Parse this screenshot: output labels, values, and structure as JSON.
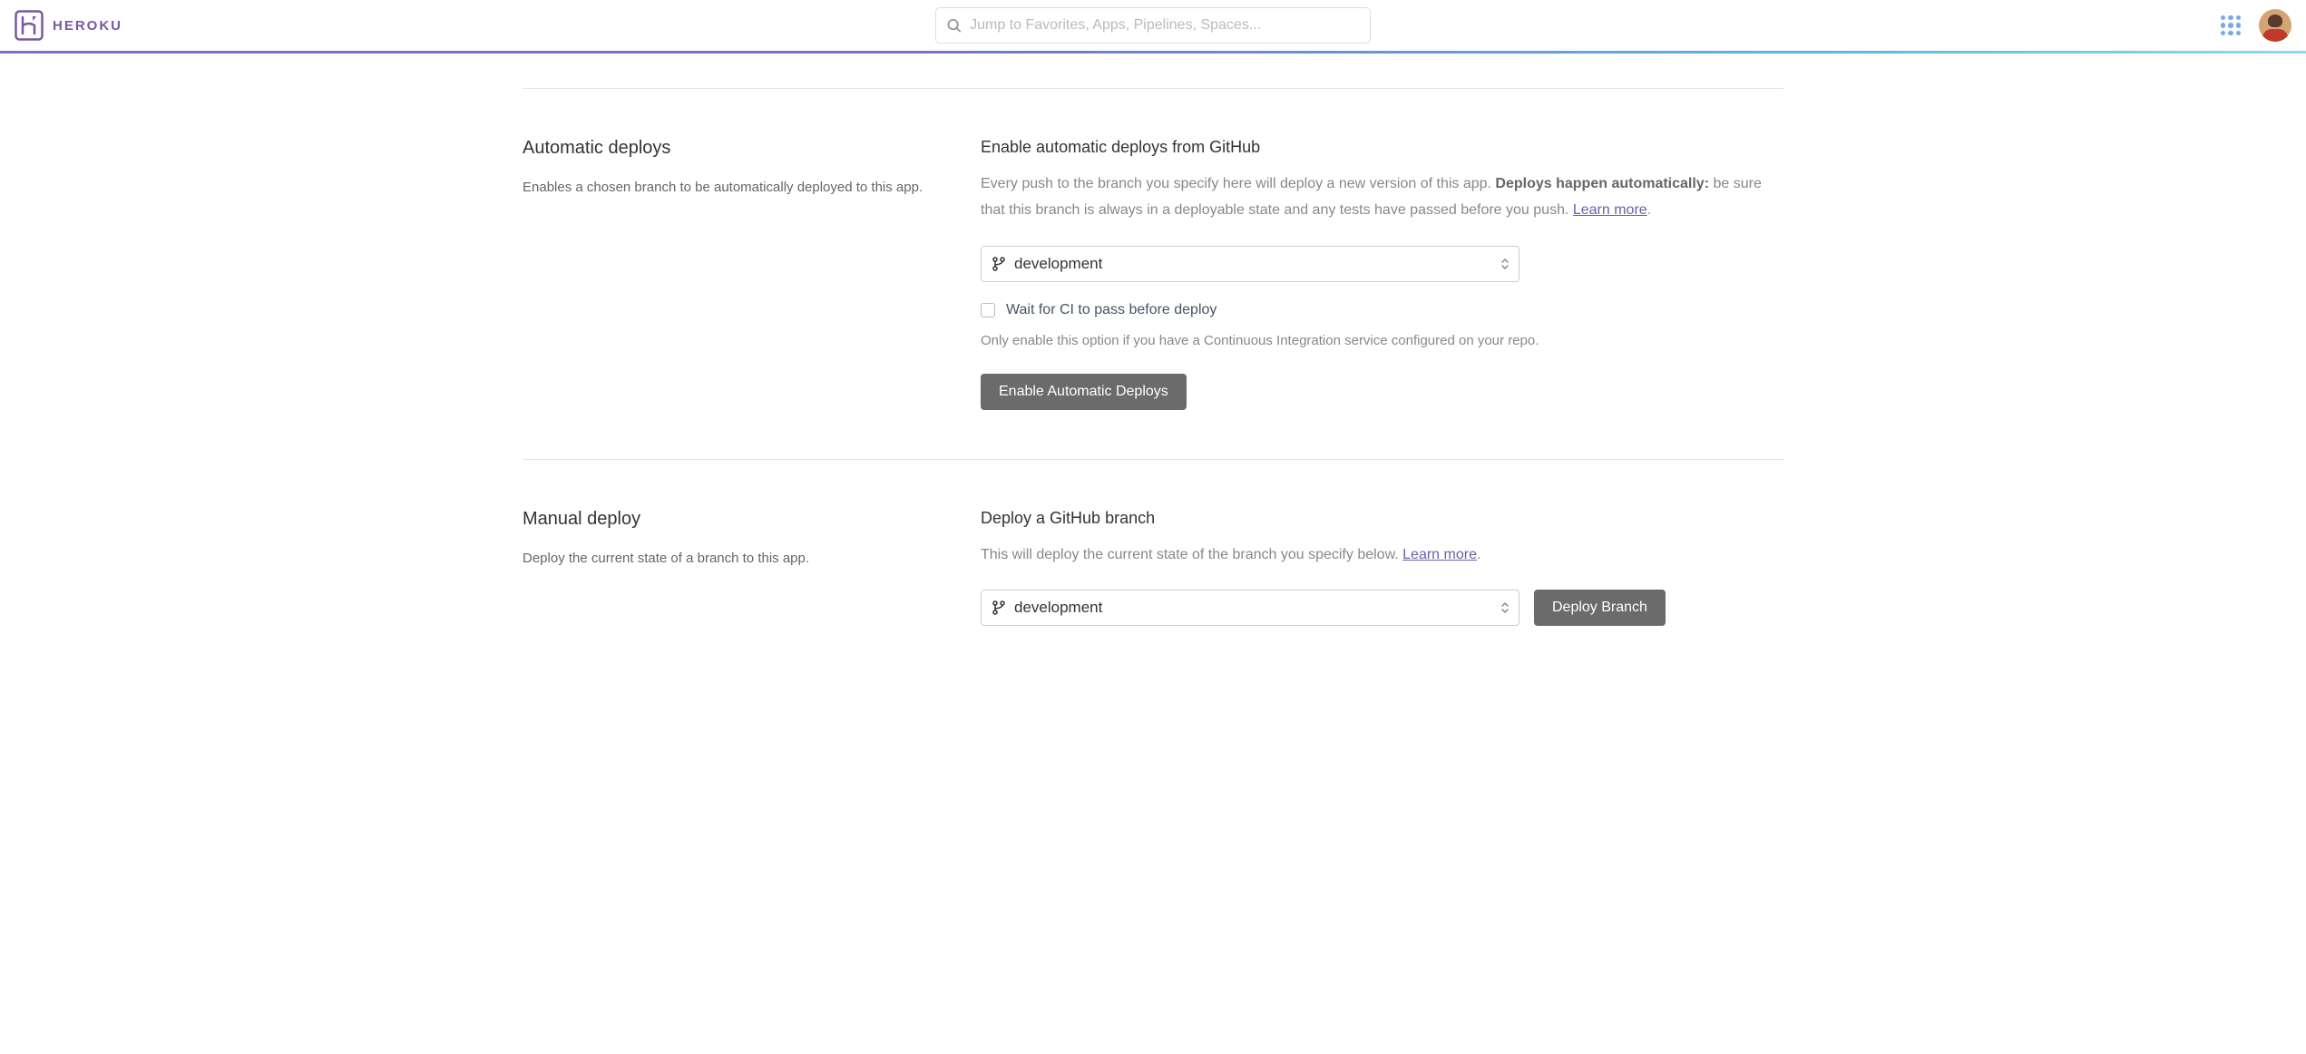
{
  "header": {
    "brand": "HEROKU",
    "search_placeholder": "Jump to Favorites, Apps, Pipelines, Spaces..."
  },
  "auto": {
    "title": "Automatic deploys",
    "subtitle": "Enables a chosen branch to be automatically deployed to this app.",
    "heading": "Enable automatic deploys from GitHub",
    "desc_part1": "Every push to the branch you specify here will deploy a new version of this app. ",
    "desc_bold": "Deploys happen automatically:",
    "desc_part2": " be sure that this branch is always in a deployable state and any tests have passed before you push. ",
    "learn_more": "Learn more",
    "period": ".",
    "branch": "development",
    "ci_label": "Wait for CI to pass before deploy",
    "ci_hint": "Only enable this option if you have a Continuous Integration service configured on your repo.",
    "button": "Enable Automatic Deploys"
  },
  "manual": {
    "title": "Manual deploy",
    "subtitle": "Deploy the current state of a branch to this app.",
    "heading": "Deploy a GitHub branch",
    "desc": "This will deploy the current state of the branch you specify below. ",
    "learn_more": "Learn more",
    "period": ".",
    "branch": "development",
    "button": "Deploy Branch"
  }
}
